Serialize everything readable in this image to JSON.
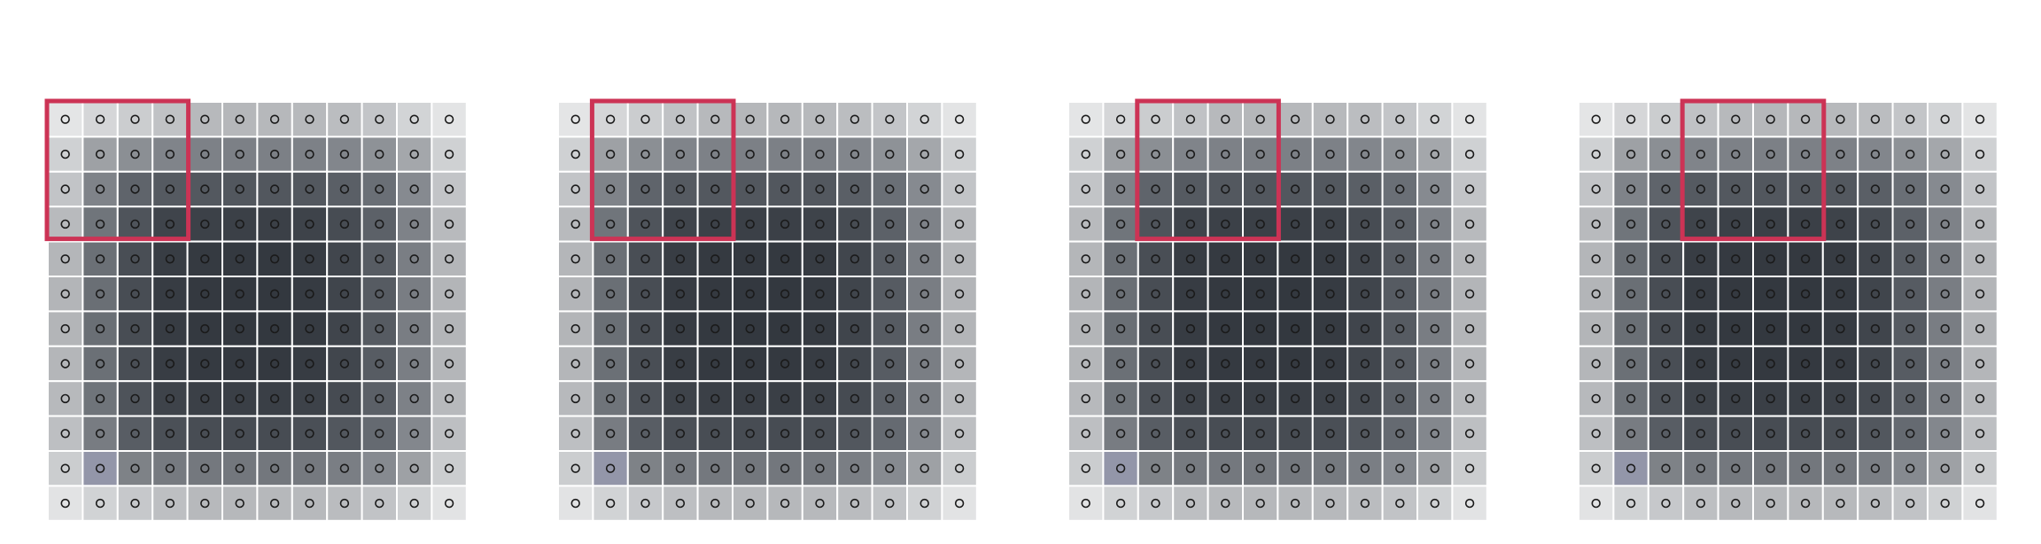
{
  "figure": {
    "panel_count": 4,
    "grid_rows": 12,
    "grid_cols": 12,
    "kernel_size": 4,
    "kernel_positions": [
      {
        "row": 0,
        "col": 0
      },
      {
        "row": 0,
        "col": 1
      },
      {
        "row": 0,
        "col": 2
      },
      {
        "row": 0,
        "col": 3
      }
    ],
    "cell_shades": [
      [
        "#e4e5e6",
        "#d5d6d8",
        "#cbcdcf",
        "#c0c2c5",
        "#b7b9bc",
        "#b5b7ba",
        "#b6b8bb",
        "#b7b9bc",
        "#bbbdc0",
        "#c3c5c8",
        "#d2d4d6",
        "#e3e4e5"
      ],
      [
        "#cfd1d3",
        "#9ea1a5",
        "#8b8f94",
        "#80848a",
        "#7d8187",
        "#7c8086",
        "#7c8086",
        "#7d8187",
        "#82868c",
        "#8e9297",
        "#a4a7ab",
        "#cfd1d3"
      ],
      [
        "#c2c4c7",
        "#7f8389",
        "#5f646b",
        "#555a61",
        "#53585f",
        "#52575e",
        "#52575e",
        "#53585f",
        "#5a5f66",
        "#6a6f76",
        "#868a90",
        "#c2c4c7"
      ],
      [
        "#b8babd",
        "#70757b",
        "#4f545b",
        "#3f444b",
        "#3c4148",
        "#3b4047",
        "#3b4047",
        "#3e434a",
        "#474c53",
        "#5c6168",
        "#7e8288",
        "#b8babd"
      ],
      [
        "#b4b6b9",
        "#6b7076",
        "#494e55",
        "#383d44",
        "#353a41",
        "#343940",
        "#343940",
        "#373c43",
        "#41464d",
        "#575c63",
        "#7a7e84",
        "#b4b6b9"
      ],
      [
        "#b3b5b8",
        "#6a6f75",
        "#484d54",
        "#373c43",
        "#343940",
        "#33383f",
        "#33383f",
        "#363b42",
        "#40454c",
        "#565b62",
        "#797d83",
        "#b3b5b8"
      ],
      [
        "#b3b5b8",
        "#6a6f75",
        "#484d54",
        "#373c43",
        "#343940",
        "#33383f",
        "#33383f",
        "#363b42",
        "#40454c",
        "#565b62",
        "#797d83",
        "#b3b5b8"
      ],
      [
        "#b4b6b9",
        "#6b7076",
        "#494e55",
        "#383d44",
        "#353a41",
        "#343940",
        "#343940",
        "#373c43",
        "#41464d",
        "#575c63",
        "#7a7e84",
        "#b4b6b9"
      ],
      [
        "#b7b9bc",
        "#6f747a",
        "#4e535a",
        "#3e434a",
        "#3b4047",
        "#3a3f46",
        "#3a3f46",
        "#3d4249",
        "#464b52",
        "#5b6067",
        "#7d8187",
        "#b7b9bc"
      ],
      [
        "#bdbfc2",
        "#787c82",
        "#585d64",
        "#4b5057",
        "#484d54",
        "#474c53",
        "#474c53",
        "#4a4f56",
        "#52575e",
        "#656a71",
        "#83878d",
        "#bdbfc2"
      ],
      [
        "#cbcdcf",
        "#9396a9",
        "#7e8287",
        "#767a80",
        "#74787e",
        "#73777d",
        "#73777d",
        "#75797f",
        "#7a7e84",
        "#868a90",
        "#9ea1a5",
        "#cbcdcf"
      ],
      [
        "#e2e3e4",
        "#d1d3d5",
        "#c6c8cb",
        "#bdbfc2",
        "#b7b9bc",
        "#b6b8bb",
        "#b6b8bb",
        "#b7b9bc",
        "#babcbf",
        "#c1c3c6",
        "#cfd1d3",
        "#e2e3e4"
      ]
    ],
    "colors": {
      "kernel_outline": "#cc3355",
      "cell_border": "#ffffff",
      "dot_outline": "#1a1a1a"
    }
  }
}
